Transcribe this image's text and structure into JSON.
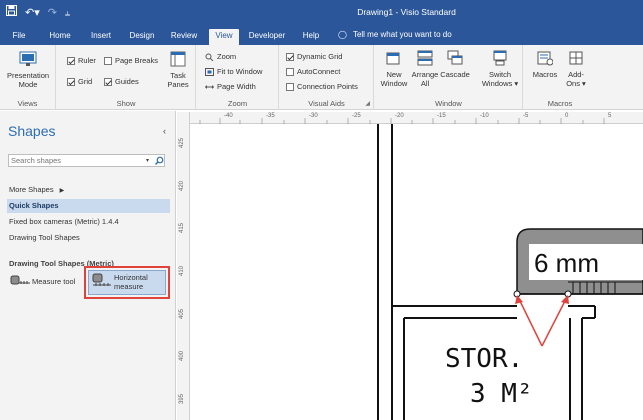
{
  "app": {
    "window_title": "Drawing1  -  Visio Standard"
  },
  "qat": {
    "save_icon": "save-icon",
    "undo_icon": "undo-icon",
    "redo_icon": "redo-icon",
    "customize_icon": "customize-qat-icon"
  },
  "tabs": [
    {
      "label": "File"
    },
    {
      "label": "Home"
    },
    {
      "label": "Insert"
    },
    {
      "label": "Design"
    },
    {
      "label": "Review"
    },
    {
      "label": "View",
      "active": true
    },
    {
      "label": "Developer"
    },
    {
      "label": "Help"
    }
  ],
  "tell_me": {
    "placeholder": "Tell me what you want to do"
  },
  "ribbon": {
    "views": {
      "label": "Views",
      "presentation_mode": "Presentation Mode"
    },
    "show": {
      "label": "Show",
      "ruler": "Ruler",
      "ruler_checked": true,
      "page_breaks": "Page Breaks",
      "page_breaks_checked": false,
      "grid": "Grid",
      "grid_checked": true,
      "guides": "Guides",
      "guides_checked": true,
      "task_panes": "Task Panes"
    },
    "zoom": {
      "label": "Zoom",
      "zoom": "Zoom",
      "fit_to_window": "Fit to Window",
      "page_width": "Page Width"
    },
    "visual_aids": {
      "label": "Visual Aids",
      "dynamic_grid": "Dynamic Grid",
      "dynamic_grid_checked": true,
      "autoconnect": "AutoConnect",
      "autoconnect_checked": false,
      "connection_points": "Connection Points",
      "connection_points_checked": false
    },
    "window": {
      "label": "Window",
      "new_window": "New Window",
      "arrange_all": "Arrange All",
      "cascade": "Cascade",
      "switch_windows": "Switch Windows"
    },
    "macros": {
      "label": "Macros",
      "macros": "Macros",
      "addons": "Add-Ons"
    }
  },
  "shapes_pane": {
    "title": "Shapes",
    "search_placeholder": "Search shapes",
    "more_shapes": "More Shapes",
    "quick_shapes": "Quick Shapes",
    "stencils": [
      "Fixed box cameras (Metric) 1.4.4",
      "Drawing Tool Shapes"
    ],
    "section_title": "Drawing Tool Shapes (Metric)",
    "masters": [
      {
        "label": "Measure tool"
      },
      {
        "label": "Horizontal measure"
      }
    ]
  },
  "ruler": {
    "h_ticks": [
      "-40",
      "-35",
      "-30",
      "-25",
      "-20",
      "-15",
      "-10",
      "-5",
      "0",
      "5"
    ],
    "v_ticks": [
      "425",
      "420",
      "415",
      "410",
      "405",
      "400",
      "395"
    ]
  },
  "drawing": {
    "measure_text": "6 mm",
    "room_label_line1": "STOR.",
    "room_label_line2": "3 M²",
    "accent_color": "#e0433b"
  }
}
